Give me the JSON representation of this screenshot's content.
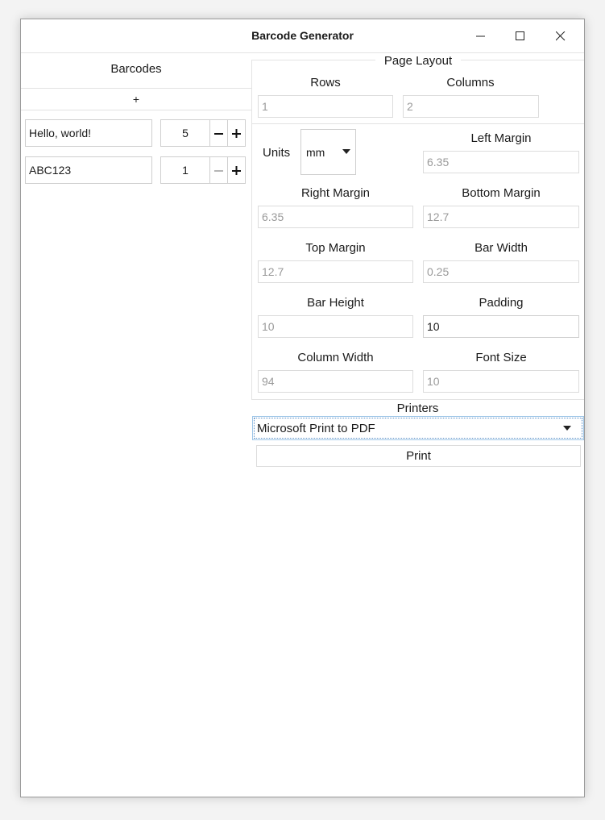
{
  "window": {
    "title": "Barcode Generator"
  },
  "barcodes": {
    "header": "Barcodes",
    "add_label": "+",
    "items": [
      {
        "text": "Hello, world!",
        "qty": "5"
      },
      {
        "text": "ABC123",
        "qty": "1"
      }
    ]
  },
  "page_layout": {
    "header": "Page Layout",
    "rows": {
      "label": "Rows",
      "value": "1"
    },
    "columns": {
      "label": "Columns",
      "value": "2"
    },
    "units": {
      "label": "Units",
      "value": "mm"
    },
    "left_margin": {
      "label": "Left Margin",
      "value": "6.35"
    },
    "right_margin": {
      "label": "Right Margin",
      "value": "6.35"
    },
    "bottom_margin": {
      "label": "Bottom Margin",
      "value": "12.7"
    },
    "top_margin": {
      "label": "Top Margin",
      "value": "12.7"
    },
    "bar_width": {
      "label": "Bar Width",
      "value": "0.25"
    },
    "bar_height": {
      "label": "Bar Height",
      "value": "10"
    },
    "padding": {
      "label": "Padding",
      "value": "10"
    },
    "column_width": {
      "label": "Column Width",
      "value": "94"
    },
    "font_size": {
      "label": "Font Size",
      "value": "10"
    }
  },
  "printers": {
    "header": "Printers",
    "selected": "Microsoft Print to PDF",
    "print_label": "Print"
  },
  "colors": {
    "border": "#cfcfcf",
    "placeholder": "#9a9a9a",
    "focus": "#5b8fc7"
  }
}
